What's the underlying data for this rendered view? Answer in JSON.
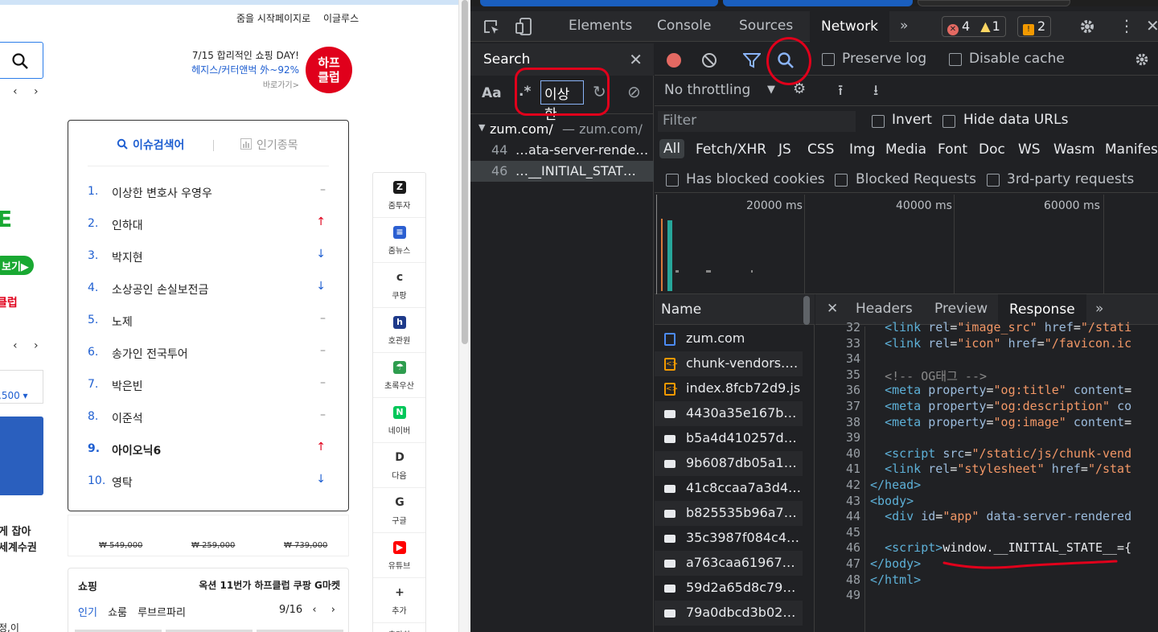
{
  "page": {
    "toplinks": [
      "줌을 시작페이지로",
      "이글루스"
    ],
    "promo": {
      "line1": "7/15 합리적인 쇼핑 DAY!",
      "line2": "헤지스/커터앤벅 外~92%",
      "line3": "바로가기>",
      "badge": "하프\n클럽"
    },
    "left_green": "E",
    "left_green_btn": "보기▶",
    "left_red": "클럽",
    "left_price": ",500 ▾",
    "left_bold": "게 잡아\n세계수권",
    "left_bottom": "정,이",
    "issue": {
      "tab_issue": "이슈검색어",
      "tab_stock": "인기종목",
      "items": [
        {
          "num": "1.",
          "keyword": "이상한 변호사 우영우",
          "trend": "–",
          "dir": "same"
        },
        {
          "num": "2.",
          "keyword": "인하대",
          "trend": "↑",
          "dir": "up"
        },
        {
          "num": "3.",
          "keyword": "박지현",
          "trend": "↓",
          "dir": "down"
        },
        {
          "num": "4.",
          "keyword": "소상공인 손실보전금",
          "trend": "↓",
          "dir": "down"
        },
        {
          "num": "5.",
          "keyword": "노제",
          "trend": "–",
          "dir": "same"
        },
        {
          "num": "6.",
          "keyword": "송가인 전국투어",
          "trend": "–",
          "dir": "same"
        },
        {
          "num": "7.",
          "keyword": "박은빈",
          "trend": "–",
          "dir": "same"
        },
        {
          "num": "8.",
          "keyword": "이준석",
          "trend": "–",
          "dir": "same"
        },
        {
          "num": "9.",
          "keyword": "아이오닉6",
          "trend": "↑",
          "dir": "up"
        },
        {
          "num": "10.",
          "keyword": "영탁",
          "trend": "↓",
          "dir": "down"
        }
      ]
    },
    "prices": [
      "₩ 549,000",
      "₩ 259,000",
      "₩ 739,000"
    ],
    "shopping": {
      "title": "쇼핑",
      "links": "옥션 11번가 하프클럽 쿠팡 G마켓",
      "tabs": [
        "인기",
        "쇼룸",
        "루브르파리"
      ],
      "page": "9/16"
    },
    "quick_links": [
      {
        "label": "줌투자",
        "icon": "Z",
        "color": "#1a1a1a"
      },
      {
        "label": "줌뉴스",
        "icon": "≡",
        "color": "#2b5fd1"
      },
      {
        "label": "쿠팡",
        "icon": "c",
        "color": "#ffffff"
      },
      {
        "label": "호관원",
        "icon": "h",
        "color": "#1e3a8a"
      },
      {
        "label": "초록우산",
        "icon": "☂",
        "color": "#2e9d4e"
      },
      {
        "label": "네이버",
        "icon": "N",
        "color": "#03c75a"
      },
      {
        "label": "다음",
        "icon": "D",
        "color": "#ffffff"
      },
      {
        "label": "구글",
        "icon": "G",
        "color": "#ffffff"
      },
      {
        "label": "유튜브",
        "icon": "▶",
        "color": "#ff0000"
      },
      {
        "label": "추가",
        "icon": "+",
        "color": "#ffffff"
      }
    ],
    "quick_more": "추가하"
  },
  "devtools": {
    "tabs": [
      "Elements",
      "Console",
      "Sources",
      "Network"
    ],
    "active_tab": "Network",
    "more": "»",
    "errors": "4",
    "warnings": "1",
    "issues": "2",
    "search": {
      "title": "Search",
      "aa": "Aa",
      "regex": ".*",
      "query": "이상한",
      "group": {
        "name": "zum.com/",
        "sub": "— zum.com/"
      },
      "results": [
        {
          "line": "44",
          "text": "…ata-server-rende…"
        },
        {
          "line": "46",
          "text": "…__INITIAL_STAT…"
        }
      ]
    },
    "network": {
      "preserve_log": "Preserve log",
      "disable_cache": "Disable cache",
      "throttling": "No throttling",
      "filter_placeholder": "Filter",
      "invert": "Invert",
      "hide_data_urls": "Hide data URLs",
      "types": [
        "All",
        "Fetch/XHR",
        "JS",
        "CSS",
        "Img",
        "Media",
        "Font",
        "Doc",
        "WS",
        "Wasm",
        "Manifest"
      ],
      "blocked_cookies": "Has blocked cookies",
      "blocked_requests": "Blocked Requests",
      "third_party": "3rd-party requests",
      "ticks": [
        "20000 ms",
        "40000 ms",
        "60000 ms"
      ],
      "name_header": "Name",
      "requests": [
        {
          "name": "zum.com",
          "type": "doc"
        },
        {
          "name": "chunk-vendors.…",
          "type": "js"
        },
        {
          "name": "index.8fcb72d9.js",
          "type": "js"
        },
        {
          "name": "4430a35e167b4…",
          "type": "img"
        },
        {
          "name": "b5a4d410257d4…",
          "type": "img"
        },
        {
          "name": "9b6087db05a14…",
          "type": "img"
        },
        {
          "name": "41c8ccaa7a3d4…",
          "type": "img"
        },
        {
          "name": "b825535b96a74…",
          "type": "img"
        },
        {
          "name": "35c3987f084c4…",
          "type": "img"
        },
        {
          "name": "a763caa619674…",
          "type": "img"
        },
        {
          "name": "59d2a65d8c794…",
          "type": "img"
        },
        {
          "name": "79a0dbcd3b024…",
          "type": "img"
        }
      ],
      "detail_tabs": [
        "Headers",
        "Preview",
        "Response"
      ],
      "active_detail": "Response",
      "code_lines": [
        {
          "no": "32",
          "html": "  <span class='tg'>&lt;link</span> <span class='at'>rel</span>=<span class='av'>\"image_src\"</span> <span class='at'>href</span>=<span class='av'>\"/stati</span>"
        },
        {
          "no": "33",
          "html": "  <span class='tg'>&lt;link</span> <span class='at'>rel</span>=<span class='av'>\"icon\"</span> <span class='at'>href</span>=<span class='av'>\"/favicon.ic</span>"
        },
        {
          "no": "34",
          "html": ""
        },
        {
          "no": "35",
          "html": "  <span class='cm'>&lt;!-- OG태그 --&gt;</span>"
        },
        {
          "no": "36",
          "html": "  <span class='tg'>&lt;meta</span> <span class='at'>property</span>=<span class='av'>\"og:title\"</span> <span class='at'>content</span>="
        },
        {
          "no": "37",
          "html": "  <span class='tg'>&lt;meta</span> <span class='at'>property</span>=<span class='av'>\"og:description\"</span> <span class='at'>co</span>"
        },
        {
          "no": "38",
          "html": "  <span class='tg'>&lt;meta</span> <span class='at'>property</span>=<span class='av'>\"og:image\"</span> <span class='at'>content</span>="
        },
        {
          "no": "39",
          "html": ""
        },
        {
          "no": "40",
          "html": "  <span class='tg'>&lt;script</span> <span class='at'>src</span>=<span class='av'>\"/static/js/chunk-vend</span>"
        },
        {
          "no": "41",
          "html": "  <span class='tg'>&lt;link</span> <span class='at'>rel</span>=<span class='av'>\"stylesheet\"</span> <span class='at'>href</span>=<span class='av'>\"/stat</span>"
        },
        {
          "no": "42",
          "html": "<span class='tg'>&lt;/head&gt;</span>"
        },
        {
          "no": "43",
          "html": "<span class='tg'>&lt;body&gt;</span>"
        },
        {
          "no": "44",
          "html": "  <span class='tg'>&lt;div</span> <span class='at'>id</span>=<span class='av'>\"app\"</span> <span class='at'>data-server-rendered</span>"
        },
        {
          "no": "45",
          "html": ""
        },
        {
          "no": "46",
          "html": "  <span class='tg'>&lt;script&gt;</span><span class='kw'>window.__INITIAL_STATE__={</span>"
        },
        {
          "no": "47",
          "html": "<span class='tg'>&lt;/body&gt;</span>"
        },
        {
          "no": "48",
          "html": "<span class='tg'>&lt;/html&gt;</span>"
        },
        {
          "no": "49",
          "html": ""
        }
      ]
    }
  }
}
